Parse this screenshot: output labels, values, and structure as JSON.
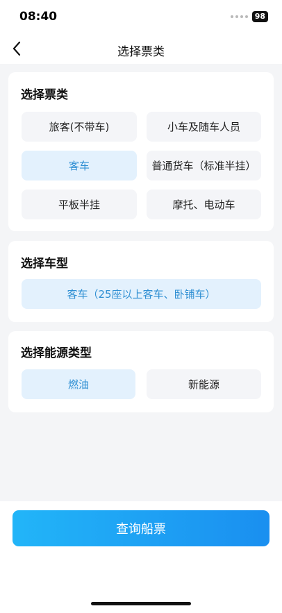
{
  "status": {
    "time": "08:40",
    "battery": "98"
  },
  "nav": {
    "title": "选择票类"
  },
  "ticket_type": {
    "title": "选择票类",
    "options": [
      "旅客(不带车)",
      "小车及随车人员",
      "客车",
      "普通货车（标准半挂）",
      "平板半挂",
      "摩托、电动车"
    ],
    "selected": "客车"
  },
  "vehicle_type": {
    "title": "选择车型",
    "options": [
      "客车（25座以上客车、卧铺车）"
    ],
    "selected": "客车（25座以上客车、卧铺车）"
  },
  "energy_type": {
    "title": "选择能源类型",
    "options": [
      "燃油",
      "新能源"
    ],
    "selected": "燃油"
  },
  "footer": {
    "query_button": "查询船票"
  },
  "colors": {
    "accent": "#2f8fd3",
    "selected_bg": "#e3f1fd",
    "button_start": "#22b5f8",
    "button_end": "#1a8ff0"
  }
}
